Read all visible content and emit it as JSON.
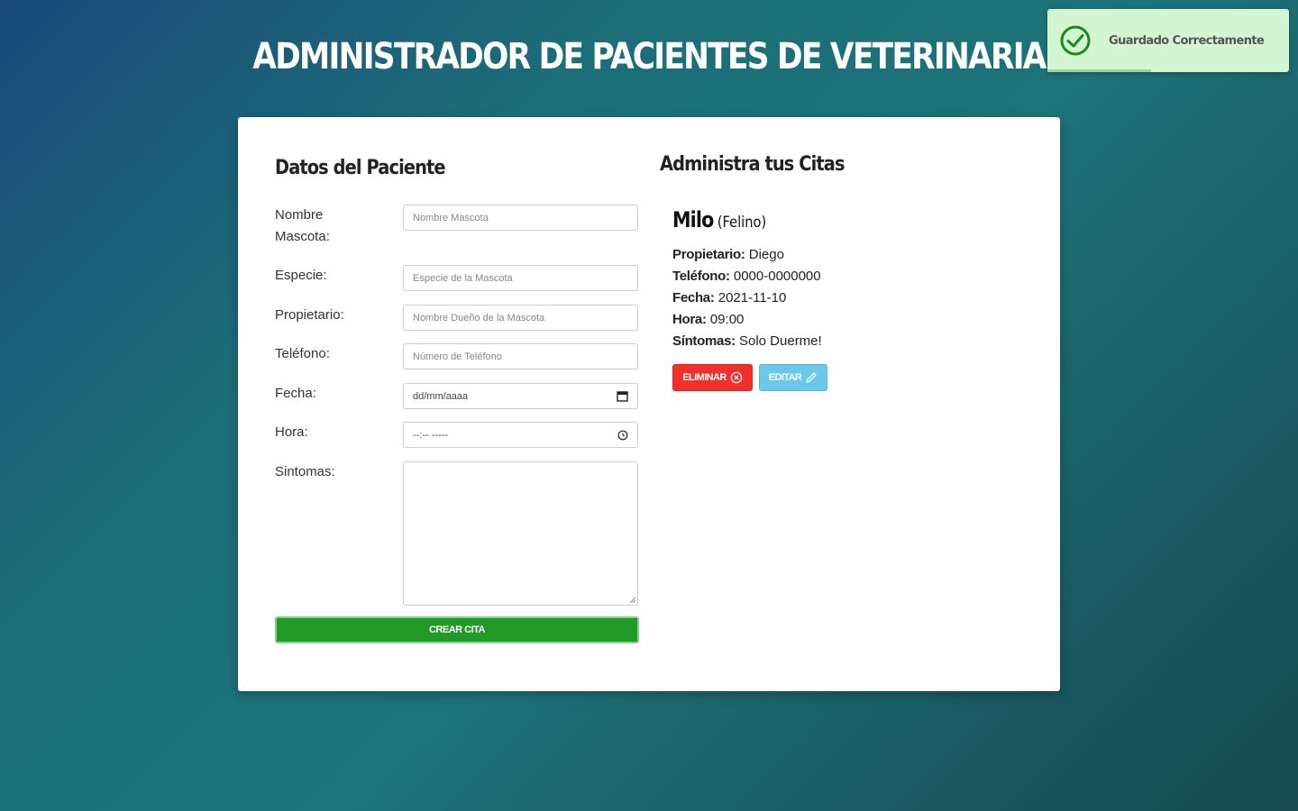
{
  "header": {
    "title": "ADMINISTRADOR DE PACIENTES DE VETERINARIA"
  },
  "toast": {
    "message": "Guardado Correctamente",
    "icon": "check-circle-icon",
    "progress": 0.43
  },
  "form": {
    "title": "Datos del Paciente",
    "fields": [
      {
        "label": "Nombre Mascota:",
        "placeholder": "Nombre Mascota"
      },
      {
        "label": "Especie:",
        "placeholder": "Especie de la Mascota"
      },
      {
        "label": "Propietario:",
        "placeholder": "Nombre Dueño de la Mascota"
      },
      {
        "label": "Teléfono:",
        "placeholder": "Número de Teléfono"
      },
      {
        "label": "Fecha:",
        "value": "dd/mm/aaaa",
        "icon": "calendar-icon"
      },
      {
        "label": "Hora:",
        "value": "--:-- -----",
        "icon": "clock-icon"
      },
      {
        "label": "Sintomas:"
      }
    ],
    "submit_label": "CREAR CITA"
  },
  "citas": {
    "title": "Administra tus Citas",
    "items": [
      {
        "name": "Milo",
        "species": "(Felino)",
        "owner_label": "Propietario:",
        "owner": "Diego",
        "phone_label": "Teléfono:",
        "phone": "0000-0000000",
        "date_label": "Fecha:",
        "date": "2021-11-10",
        "time_label": "Hora:",
        "time": "09:00",
        "symptoms_label": "Síntomas:",
        "symptoms": "Solo Duerme!",
        "delete_label": "ELIMINAR",
        "edit_label": "EDITAR"
      }
    ]
  },
  "colors": {
    "success": "#23992a",
    "danger": "#f2302b",
    "info": "#6ac8ea",
    "toast_bg": "#d4f5d2"
  }
}
